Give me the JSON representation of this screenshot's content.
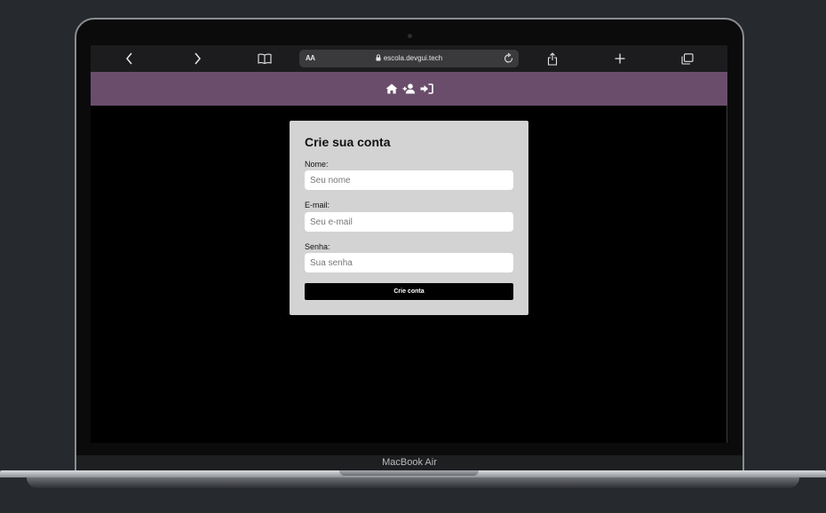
{
  "browser": {
    "reader_label": "AA",
    "url": "escola.devgui.tech"
  },
  "nav": {
    "icons": [
      "home-icon",
      "user-plus-icon",
      "sign-in-icon"
    ]
  },
  "form": {
    "title": "Crie sua conta",
    "name_label": "Nome:",
    "name_placeholder": "Seu nome",
    "email_label": "E-mail:",
    "email_placeholder": "Seu e-mail",
    "password_label": "Senha:",
    "password_placeholder": "Sua senha",
    "submit_label": "Crie conta"
  },
  "device": {
    "label": "MacBook Air"
  },
  "colors": {
    "navbar": "#6a4d6b",
    "card": "#d3d3d3",
    "page_bg": "#000000",
    "backdrop": "#262a2f"
  }
}
